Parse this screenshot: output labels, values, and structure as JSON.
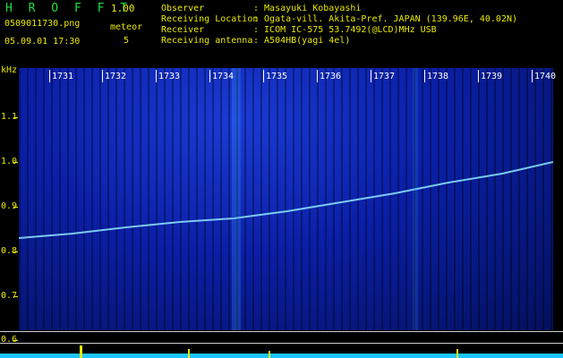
{
  "header": {
    "app_title": "H R O F F T",
    "app_version": "1.00",
    "file_name": "0509011730.png",
    "meteor_label": "meteor",
    "meteor_count": "5",
    "date_time": "05.09.01 17:30"
  },
  "info": [
    {
      "label": "Observer",
      "value": ": Masayuki Kobayashi"
    },
    {
      "label": "Receiving Location",
      "value": ": Ogata-vill. Akita-Pref. JAPAN (139.96E, 40.02N)"
    },
    {
      "label": "Receiver",
      "value": ": ICOM IC-575 53.7492(@LCD)MHz USB"
    },
    {
      "label": "Receiving antenna",
      "value": ": A504HB(yagi 4el)"
    }
  ],
  "axis": {
    "unit": "kHz",
    "y_ticks": [
      "1.1",
      "1.0",
      "0.9",
      "0.8",
      "0.7",
      "0.6"
    ],
    "x_ticks": [
      "1731",
      "1732",
      "1733",
      "1734",
      "1735",
      "1736",
      "1737",
      "1738",
      "1739",
      "1740"
    ]
  },
  "colors": {
    "background": "#000000",
    "label_yellow": "#e8e800",
    "title_green": "#1fdf3f",
    "spectrum_blue": "#0a1fa8",
    "trace_cyan": "#8fe8ff"
  }
}
